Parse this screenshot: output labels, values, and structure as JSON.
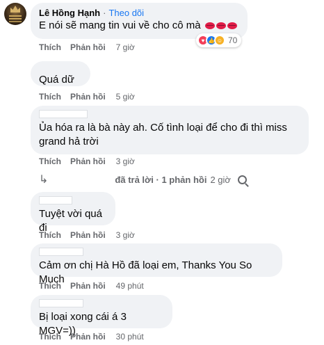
{
  "comments": [
    {
      "name": "Lê Hồng Hạnh",
      "follow": "Theo dõi",
      "separator": "·",
      "text": "E nói sẽ mang tin vui về cho cô mà",
      "like": "Thích",
      "reply": "Phản hồi",
      "time": "7 giờ",
      "reaction_count": "70",
      "reaction_icons": [
        "love-icon",
        "like-icon",
        "haha-icon"
      ],
      "emoji": "kiss-lips-icon x3"
    },
    {
      "text": "Quá dữ",
      "like": "Thích",
      "reply": "Phản hồi",
      "time": "5 giờ"
    },
    {
      "text": "Ủa hóa ra là bà này ah. Cố tình loại để cho đi thì miss grand hả trời",
      "like": "Thích",
      "reply": "Phản hồi",
      "time": "3 giờ"
    },
    {
      "text": "Tuyệt vời quá đi",
      "like": "Thích",
      "reply": "Phản hồi",
      "time": "3 giờ"
    },
    {
      "text": "Cảm ơn chị Hà Hồ đã loại em, Thanks You So Much",
      "like": "Thích",
      "reply": "Phản hồi",
      "time": "49 phút"
    },
    {
      "text": "Bị loại xong cái á 3 MGV=))",
      "like": "Thích",
      "reply": "Phản hồi",
      "time": "30 phút"
    }
  ],
  "replies": {
    "label": "đã trả lời · 1 phản hồi",
    "time": "2 giờ"
  },
  "colors": {
    "bubble": "#f0f2f5",
    "link": "#1877f2",
    "muted": "#65676b"
  }
}
